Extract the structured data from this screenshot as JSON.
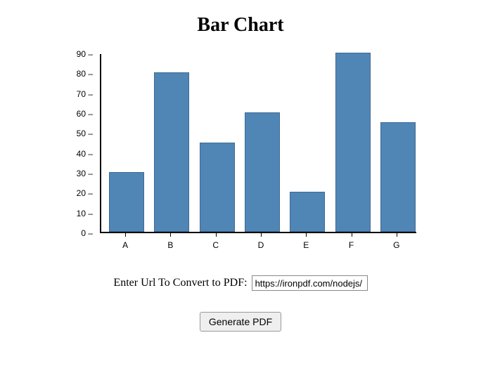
{
  "title": "Bar Chart",
  "chart_data": {
    "type": "bar",
    "categories": [
      "A",
      "B",
      "C",
      "D",
      "E",
      "F",
      "G"
    ],
    "values": [
      30,
      80,
      45,
      60,
      20,
      90,
      55
    ],
    "title": "Bar Chart",
    "xlabel": "",
    "ylabel": "",
    "ylim": [
      0,
      90
    ],
    "yticks": [
      0,
      10,
      20,
      30,
      40,
      50,
      60,
      70,
      80,
      90
    ]
  },
  "colors": {
    "bar_fill": "#5086b6",
    "bar_stroke": "#3f6a91"
  },
  "form": {
    "label": "Enter Url To Convert to PDF:",
    "url_value": "https://ironpdf.com/nodejs/"
  },
  "buttons": {
    "generate_label": "Generate PDF"
  }
}
